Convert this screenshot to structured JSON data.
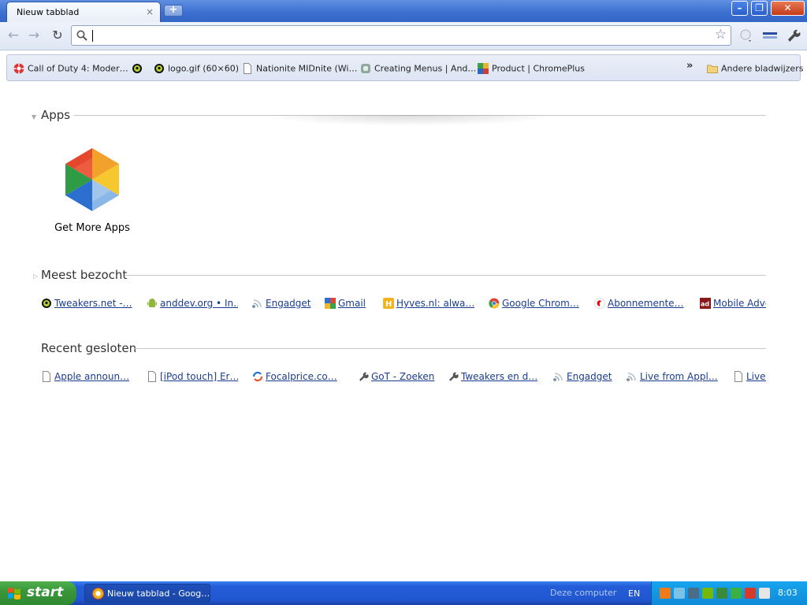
{
  "window": {
    "tab_title": "Nieuw tabblad",
    "tab_close": "×",
    "new_tab": "+",
    "min": "–",
    "max": "❐",
    "close": "✕"
  },
  "toolbar": {
    "back": "←",
    "forward": "→",
    "reload": "↻",
    "address_value": "",
    "star": "☆"
  },
  "bookmarks": {
    "items": [
      {
        "label": "Call of Duty 4: Moder…",
        "icon": "cod-icon"
      },
      {
        "label": "",
        "icon": "tweakers-icon"
      },
      {
        "label": "logo.gif (60×60)",
        "icon": "tweakers-icon"
      },
      {
        "label": "Nationite MIDnite (Wi…",
        "icon": "page-icon"
      },
      {
        "label": "Creating Menus | And…",
        "icon": "android-dev-icon"
      },
      {
        "label": "Product | ChromePlus",
        "icon": "chromeplus-icon"
      }
    ],
    "overflow": "»",
    "other": "Andere bladwijzers"
  },
  "ntp": {
    "apps_heading": "Apps",
    "get_more_apps": "Get More Apps",
    "most_visited_heading": "Meest bezocht",
    "most_visited": [
      {
        "label": "Tweakers.net -…",
        "icon": "tweakers-icon"
      },
      {
        "label": "anddev.org • In…",
        "icon": "android-icon"
      },
      {
        "label": "Engadget",
        "icon": "rss-icon"
      },
      {
        "label": "Gmail",
        "icon": "gmail-icon"
      },
      {
        "label": "Hyves.nl: alwa…",
        "icon": "hyves-icon"
      },
      {
        "label": "Google Chrom…",
        "icon": "chrome-icon"
      },
      {
        "label": "Abonnemente…",
        "icon": "vodafone-icon"
      },
      {
        "label": "Mobile Adve",
        "icon": "ad-icon"
      }
    ],
    "recently_closed_heading": "Recent gesloten",
    "recently_closed": [
      {
        "label": "Apple announ…",
        "icon": "page-icon"
      },
      {
        "label": "[iPod touch] Er…",
        "icon": "page-icon"
      },
      {
        "label": "Focalprice.co…",
        "icon": "focalprice-icon"
      },
      {
        "label": "GoT - Zoeken",
        "icon": "wrench-icon"
      },
      {
        "label": "Tweakers en d…",
        "icon": "wrench-icon"
      },
      {
        "label": "Engadget",
        "icon": "rss-icon"
      },
      {
        "label": "Live from Appl…",
        "icon": "rss-icon"
      },
      {
        "label": "Liveb",
        "icon": "page-icon"
      }
    ]
  },
  "taskbar": {
    "start": "start",
    "task_label": "Nieuw tabblad - Goog…",
    "deze_computer": "Deze computer",
    "lang": "EN",
    "clock": "8:03"
  },
  "colors": {
    "link": "#1a3d8f",
    "xp_blue": "#245dd8",
    "start_green": "#39963a",
    "tray_blue": "#0f8ad9"
  }
}
